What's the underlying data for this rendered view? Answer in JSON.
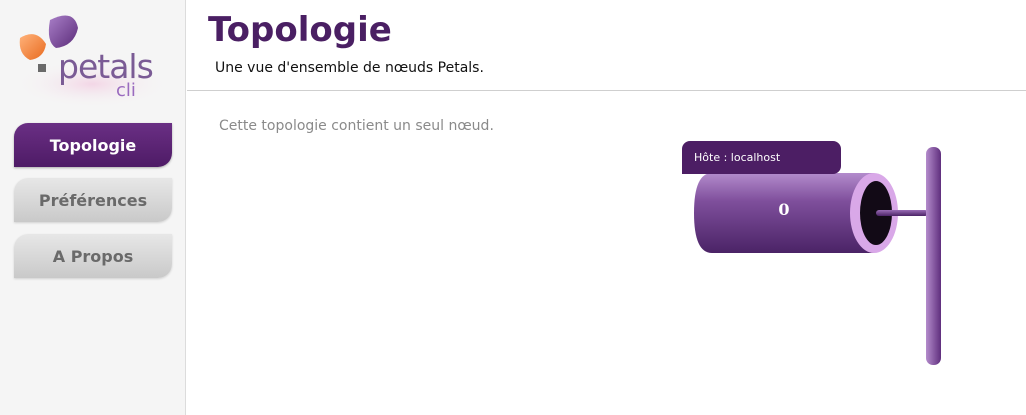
{
  "sidebar": {
    "logo": {
      "brand": "petals",
      "sub": "cli"
    },
    "items": [
      {
        "label": "Topologie",
        "active": true
      },
      {
        "label": "Préférences",
        "active": false
      },
      {
        "label": "A Propos",
        "active": false
      }
    ]
  },
  "header": {
    "title": "Topologie",
    "subtitle": "Une vue d'ensemble de nœuds Petals."
  },
  "main": {
    "info": "Cette topologie contient un seul nœud.",
    "node": {
      "host_label": "Hôte : localhost",
      "count": "0"
    }
  },
  "colors": {
    "accent": "#4c1e64",
    "node_body": "#7f4f9c",
    "node_rim": "#d9a8e8",
    "nav_inactive": "#d6d6d6"
  }
}
